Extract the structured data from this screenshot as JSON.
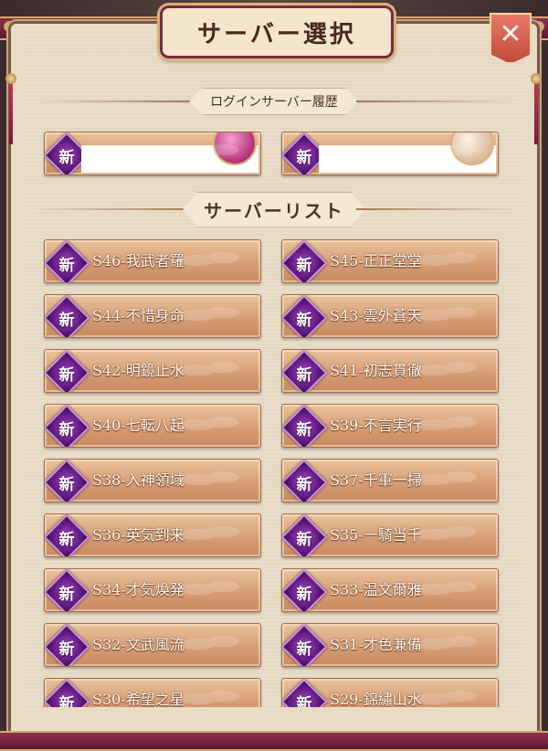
{
  "dialog": {
    "title": "サーバー選択",
    "close_icon": "close-icon"
  },
  "history": {
    "label": "ログインサーバー履歴",
    "badge": "新",
    "entries": [
      {
        "avatar_color": "#d7559a"
      },
      {
        "avatar_color": "#e8d0b8"
      }
    ]
  },
  "server_list": {
    "label": "サーバーリスト",
    "badge": "新",
    "servers": [
      "S46-我武者羅",
      "S45-正正堂堂",
      "S44-不惜身命",
      "S43-雲外蒼天",
      "S42-明鏡止水",
      "S41-初志貫徹",
      "S40-七転八起",
      "S39-不言実行",
      "S38-入神領域",
      "S37-千軍一掃",
      "S36-英気到来",
      "S35-一騎当千",
      "S34-才気煥発",
      "S33-温文爾雅",
      "S32-文武風流",
      "S31-才色兼備",
      "S30-希望之星",
      "S29-錦繡山水"
    ]
  },
  "colors": {
    "frame": "#7a2a46",
    "button": "#d49b72",
    "badge": "#6a1f8a",
    "close": "#c04a3a"
  }
}
